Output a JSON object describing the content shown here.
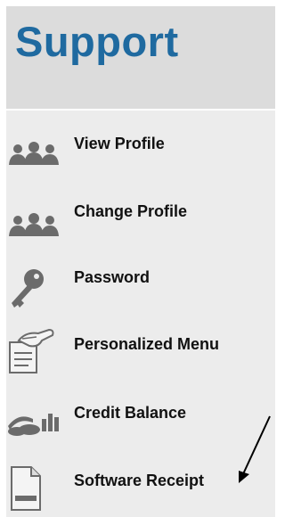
{
  "header": {
    "title": "Support"
  },
  "menu": {
    "items": [
      {
        "label": "View Profile",
        "icon": "users-icon"
      },
      {
        "label": "Change Profile",
        "icon": "users-icon"
      },
      {
        "label": "Password",
        "icon": "key-icon"
      },
      {
        "label": "Personalized Menu",
        "icon": "hand-document-icon"
      },
      {
        "label": "Credit Balance",
        "icon": "coins-chart-icon"
      },
      {
        "label": "Software Receipt",
        "icon": "invoice-document-icon"
      }
    ]
  },
  "colors": {
    "title": "#1f6aa0",
    "header_bg": "#dcdcdc",
    "menu_bg": "#ececec",
    "icon": "#6b6b6b"
  }
}
